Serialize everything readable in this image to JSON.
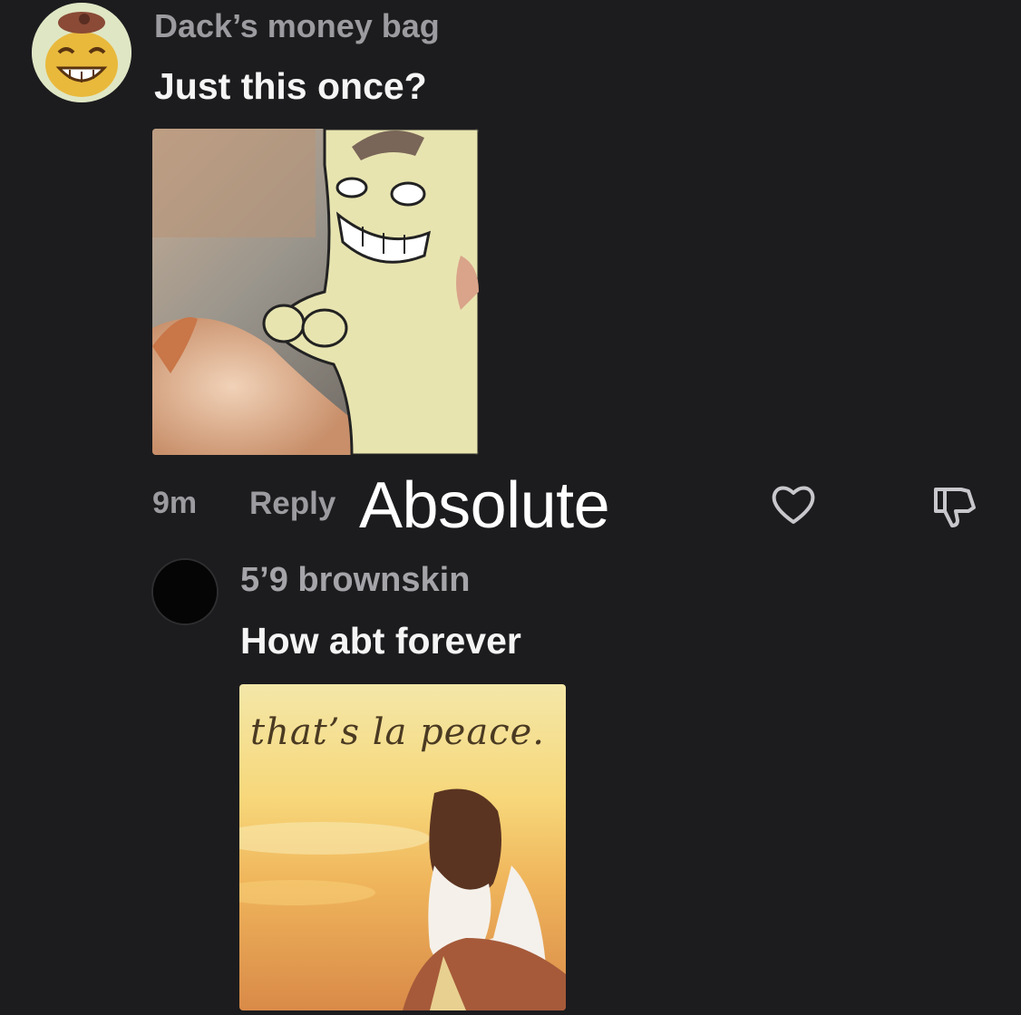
{
  "comments": [
    {
      "username": "Dack’s money bag",
      "text": "Just this once?",
      "avatar_icon": "cartoon-grin-avatar",
      "image_icon": "cartoon-hand-offer-meme",
      "time": "9m",
      "reply_label": "Reply"
    },
    {
      "username": "5’9 brownskin",
      "text": "How abt forever",
      "avatar_icon": "black-circle-avatar",
      "image_icon": "thats-la-peace-meme",
      "image_caption": "that’s la peace."
    }
  ],
  "overlay_caption": "Absolute",
  "icons": {
    "like": "heart-outline-icon",
    "dislike": "thumbs-down-outline-icon"
  },
  "colors": {
    "background": "#1c1c1e",
    "secondary_text": "#9c9ca0",
    "primary_text": "#f5f5f5"
  }
}
